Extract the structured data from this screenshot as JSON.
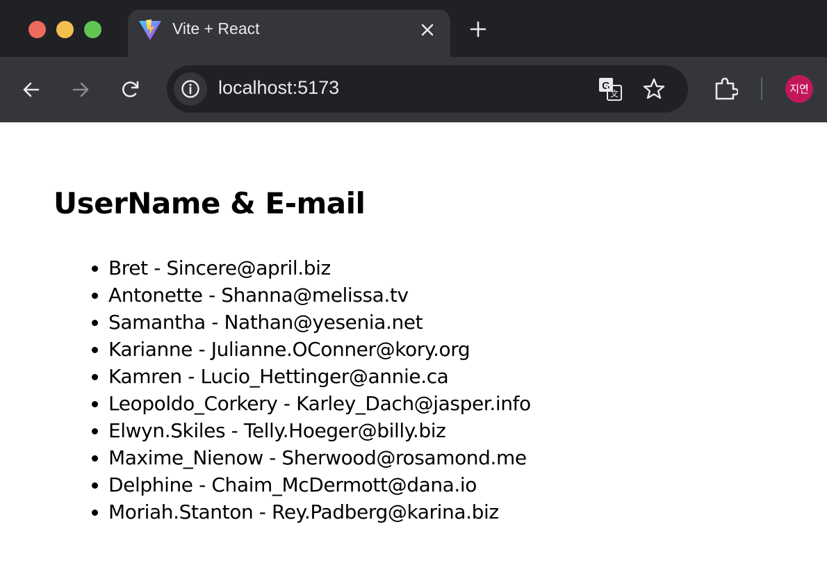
{
  "browser": {
    "tab": {
      "title": "Vite + React",
      "favicon": "vite-logo"
    },
    "address_bar": {
      "url": "localhost:5173"
    },
    "profile": {
      "initials": "지연",
      "color": "#c2185b"
    },
    "icons": [
      "back-icon",
      "forward-icon",
      "reload-icon",
      "site-info-icon",
      "translate-icon",
      "bookmark-star-icon",
      "extensions-icon"
    ]
  },
  "page": {
    "heading": "UserName & E-mail",
    "users": [
      {
        "username": "Bret",
        "email": "Sincere@april.biz"
      },
      {
        "username": "Antonette",
        "email": "Shanna@melissa.tv"
      },
      {
        "username": "Samantha",
        "email": "Nathan@yesenia.net"
      },
      {
        "username": "Karianne",
        "email": "Julianne.OConner@kory.org"
      },
      {
        "username": "Kamren",
        "email": "Lucio_Hettinger@annie.ca"
      },
      {
        "username": "Leopoldo_Corkery",
        "email": "Karley_Dach@jasper.info"
      },
      {
        "username": "Elwyn.Skiles",
        "email": "Telly.Hoeger@billy.biz"
      },
      {
        "username": "Maxime_Nienow",
        "email": "Sherwood@rosamond.me"
      },
      {
        "username": "Delphine",
        "email": "Chaim_McDermott@dana.io"
      },
      {
        "username": "Moriah.Stanton",
        "email": "Rey.Padberg@karina.biz"
      }
    ]
  }
}
